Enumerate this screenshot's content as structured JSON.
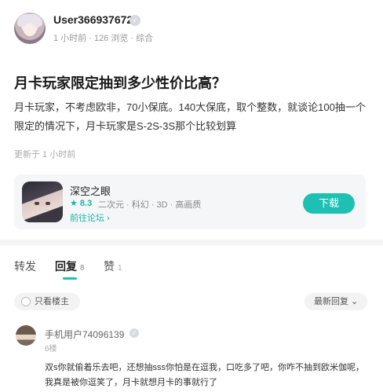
{
  "post": {
    "author": "User366937672",
    "badge_icon": "verified-badge-icon",
    "meta": "1 小时前 · 126 浏览 · 综合",
    "title": "月卡玩家限定抽到多少性价比高？",
    "content": "月卡玩家，不考虑欧非，70小保底。140大保底，取个整数，就谈论100抽一个限定的情况下，月卡玩家是S-2S-3S那个比较划算",
    "updated": "更新于 1 小时前"
  },
  "game": {
    "name": "深空之眼",
    "score": "★ 8.3",
    "tags": "二次元 · 科幻 · 3D · 高画质",
    "forum_link": "前往论坛 ›",
    "download_label": "下载"
  },
  "tabs": [
    {
      "label": "转发",
      "count": ""
    },
    {
      "label": "回复",
      "count": "8"
    },
    {
      "label": "赞",
      "count": "1"
    }
  ],
  "filters": {
    "only_author": "只看楼主",
    "sort": "最新回复 ⌄"
  },
  "reply": {
    "user": "手机用户74096139",
    "floor": "6楼",
    "text": "双s你就偷着乐去吧，还想抽sss你怕是在逗我，口吃多了吧，你咋不抽到欧米伽呢，我真是被你逗笑了，月卡就想月卡的事就行了"
  },
  "colors": {
    "accent": "#1ec0b4",
    "background": "#f5f5f5"
  }
}
